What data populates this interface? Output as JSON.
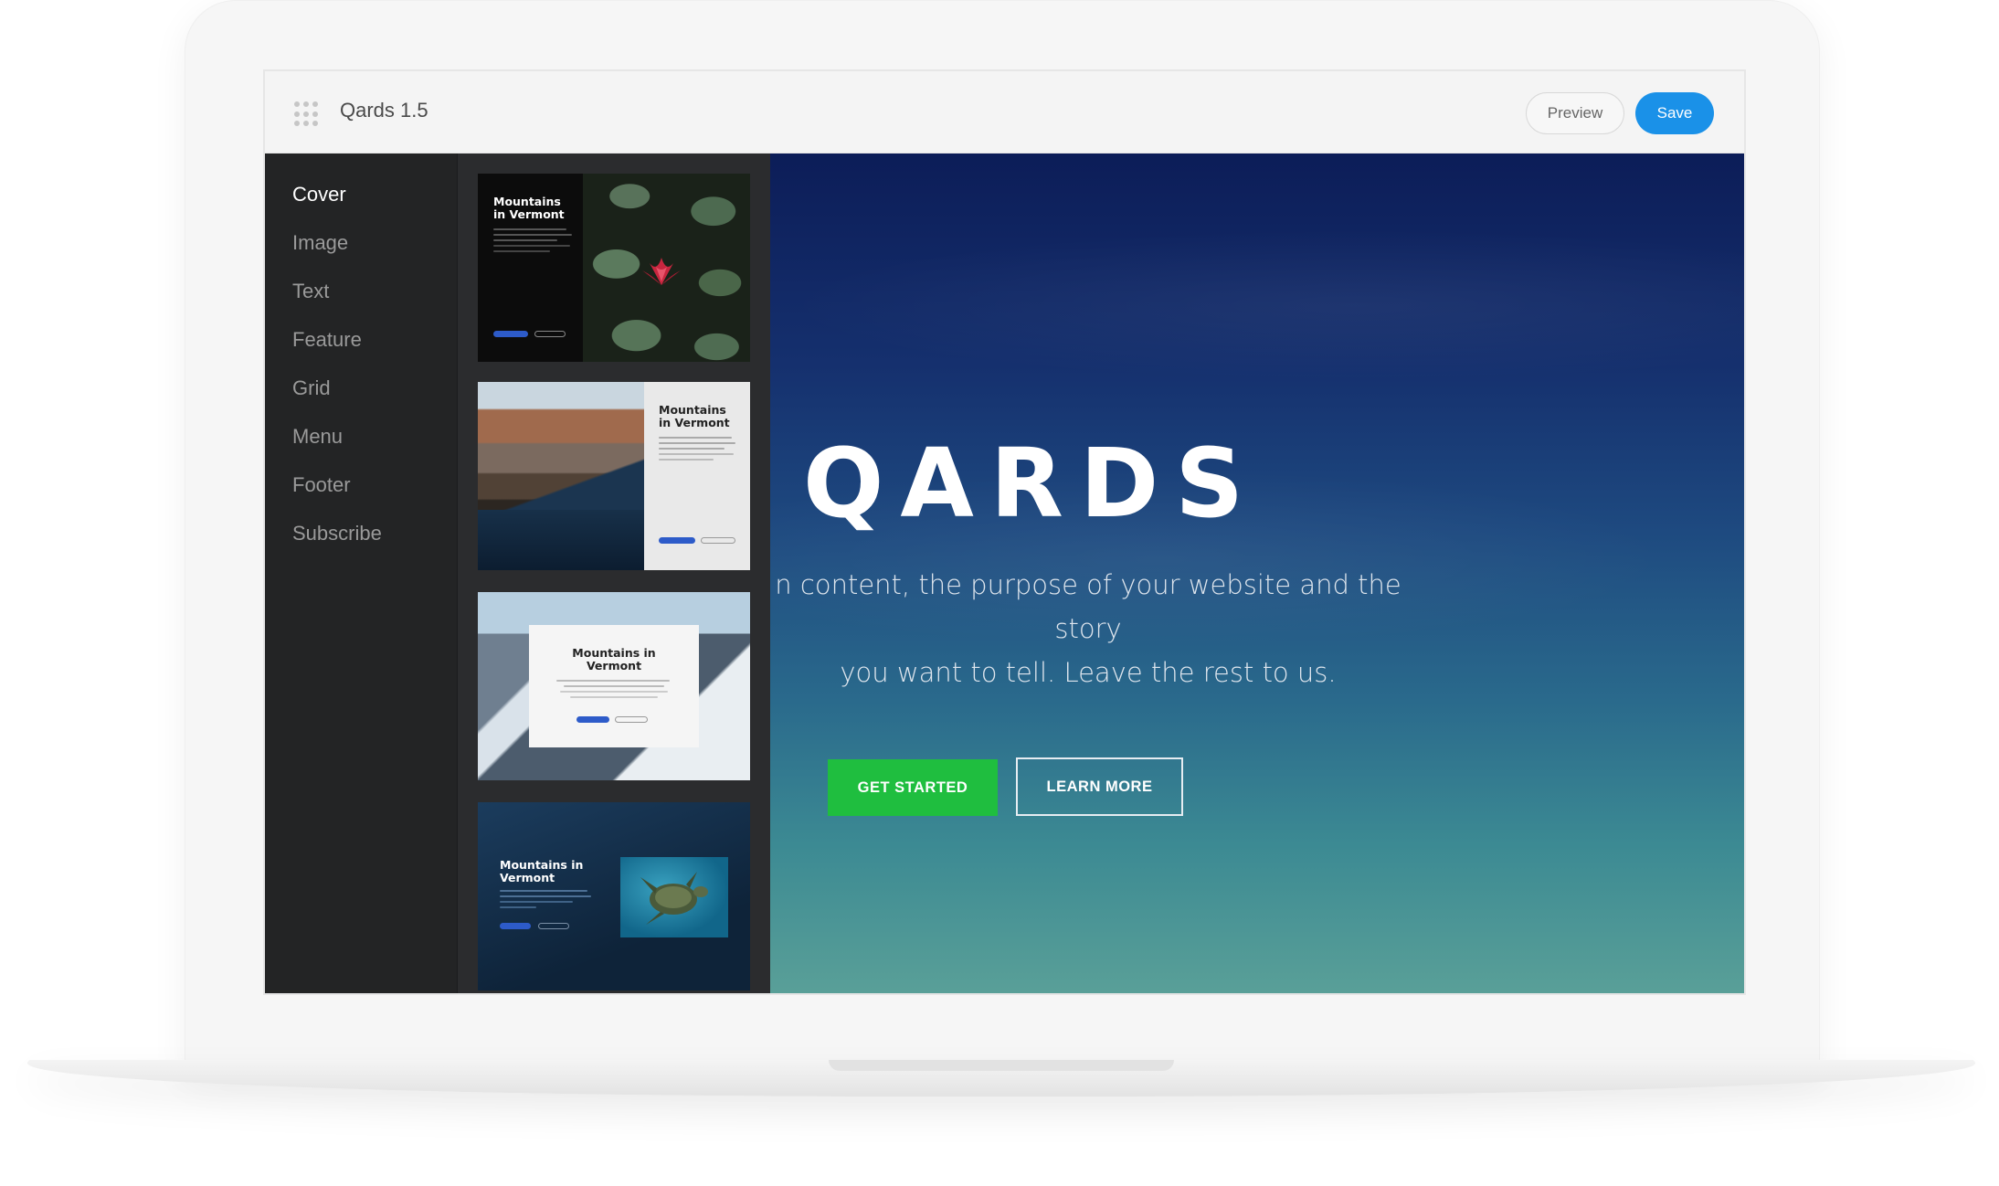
{
  "app": {
    "title": "Qards 1.5"
  },
  "toolbar": {
    "preview_label": "Preview",
    "save_label": "Save"
  },
  "sidebar": {
    "items": [
      {
        "label": "Cover",
        "active": true
      },
      {
        "label": "Image"
      },
      {
        "label": "Text"
      },
      {
        "label": "Feature"
      },
      {
        "label": "Grid"
      },
      {
        "label": "Menu"
      },
      {
        "label": "Footer"
      },
      {
        "label": "Subscribe"
      }
    ]
  },
  "thumbnails": [
    {
      "title": "Mountains in Vermont"
    },
    {
      "title": "Mountains in Vermont"
    },
    {
      "title": "Mountains in Vermont"
    },
    {
      "title": "Mountains in Vermont"
    }
  ],
  "hero": {
    "title": "QARDS",
    "text_line1": "n content, the purpose of your website and the story",
    "text_line2": "you want to tell. Leave the rest to us.",
    "primary_button": "GET STARTED",
    "secondary_button": "LEARN MORE"
  },
  "colors": {
    "accent": "#1a91e8",
    "primary_button": "#1fbe3f",
    "sidebar_bg": "#232425"
  }
}
